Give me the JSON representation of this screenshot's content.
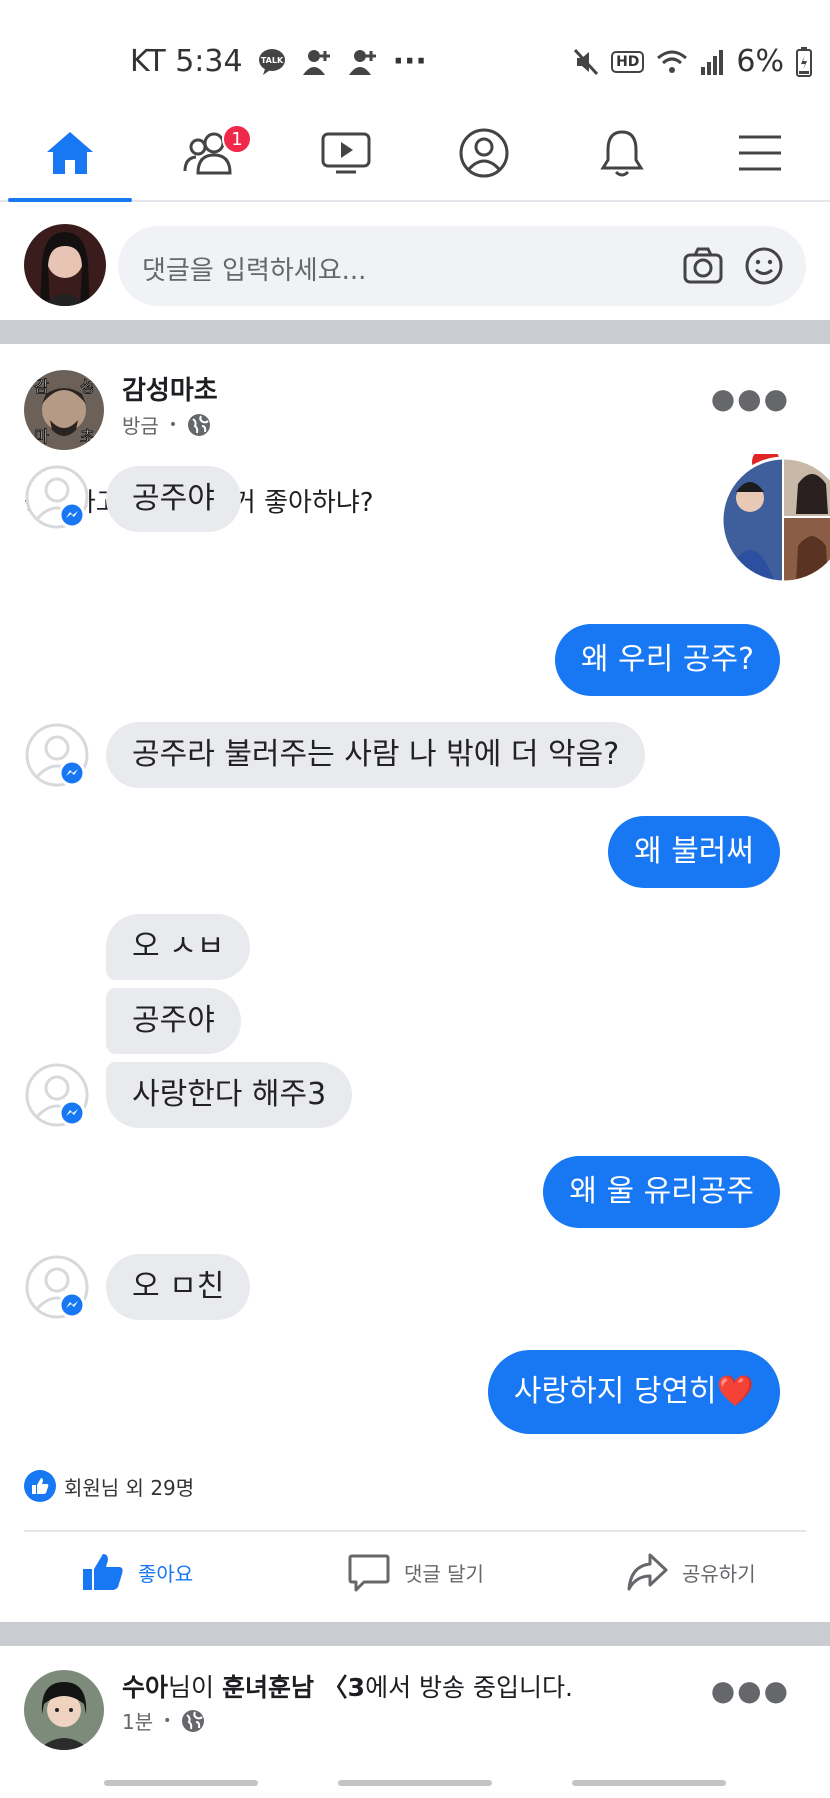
{
  "status_bar": {
    "carrier_time": "KT 5:34",
    "talk_label": "TALK",
    "hd_label": "HD",
    "battery": "6%",
    "more": "···"
  },
  "nav": {
    "friends_badge": "1"
  },
  "composer": {
    "placeholder": "댓글을 입력하세요..."
  },
  "post": {
    "author": "감성마초",
    "time": "방금",
    "separator": "•",
    "text": "공주라고 불러주는 거 좋아하냐?",
    "avatar_text": [
      "감",
      "성",
      "마",
      "초"
    ]
  },
  "chat": {
    "messages": [
      {
        "side": "in",
        "text": "공주야"
      },
      {
        "side": "out",
        "text": "왜 우리 공주?"
      },
      {
        "side": "in",
        "text": "공주라 불러주는 사람 나 밖에 더 악음?"
      },
      {
        "side": "out",
        "text": "왜 불러써"
      },
      {
        "side": "in",
        "text": "오 ㅅㅂ"
      },
      {
        "side": "in",
        "text": "공주야"
      },
      {
        "side": "in",
        "text": "사랑한다 해주3"
      },
      {
        "side": "out",
        "text": "왜 울 유리공주"
      },
      {
        "side": "in",
        "text": "오 ㅁ친"
      },
      {
        "side": "out",
        "text": "사랑하지 당연히❤️"
      }
    ]
  },
  "reactions": {
    "text": "회원님 외 29명"
  },
  "actions": {
    "like": "좋아요",
    "comment": "댓글 달기",
    "share": "공유하기"
  },
  "post2": {
    "name": "수아",
    "suffix1": "님이 ",
    "page": "훈녀훈남 〈3",
    "suffix2": "에서 방송 중입니다.",
    "time": "1분",
    "separator": "•"
  },
  "colors": {
    "accent": "#1877f2",
    "badge": "#f02849",
    "bubble_in": "#e9eaee"
  }
}
